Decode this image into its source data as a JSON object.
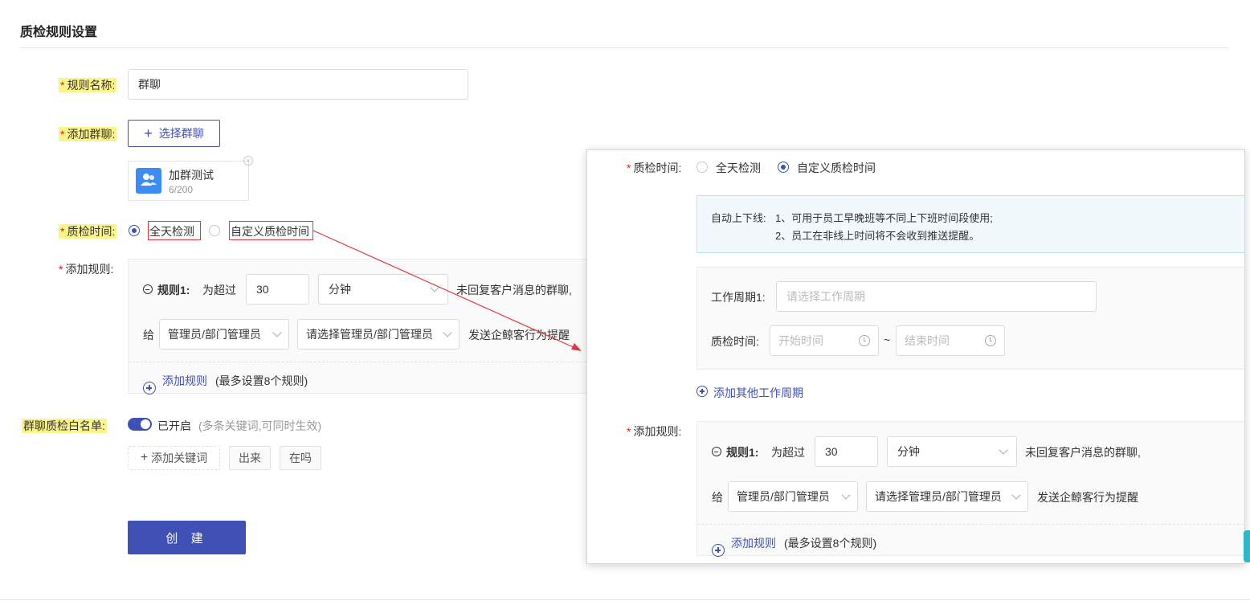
{
  "page": {
    "title": "质检规则设置"
  },
  "form": {
    "rule_name": {
      "label": "规则名称:",
      "value": "群聊"
    },
    "add_group": {
      "label": "添加群聊:",
      "button_label": "选择群聊"
    },
    "group_card": {
      "name": "加群测试",
      "count": "6/200",
      "logo_text": "群聊"
    },
    "check_time": {
      "label": "质检时间:",
      "options": [
        "全天检测",
        "自定义质检时间"
      ],
      "selected": "全天检测"
    },
    "add_rules": {
      "label": "添加规则:",
      "rule": {
        "name": "规则1:",
        "prefix": "为超过",
        "minutes": "30",
        "unit": "分钟",
        "suffix": "未回复客户消息的群聊,",
        "give": "给",
        "role": "管理员/部门管理员",
        "manager_placeholder": "请选择管理员/部门管理员",
        "action": "发送企鲸客行为提醒"
      },
      "add_link": "添加规则",
      "add_hint": "(最多设置8个规则)"
    },
    "whitelist": {
      "label": "群聊质检白名单:",
      "status": "已开启",
      "hint": "(多条关键词,可同时生效)",
      "add_keyword": "添加关键词",
      "tags": [
        "出来",
        "在吗"
      ]
    },
    "submit_label": "创 建"
  },
  "overlay": {
    "check_time": {
      "label": "质检时间:",
      "options": [
        "全天检测",
        "自定义质检时间"
      ],
      "selected": "自定义质检时间"
    },
    "notice": {
      "title": "自动上下线:",
      "lines": [
        "1、可用于员工早晚班等不同上下班时间段使用;",
        "2、员工在非线上时间将不会收到推送提醒。"
      ]
    },
    "work_cycle": {
      "label": "工作周期1:",
      "placeholder": "请选择工作周期",
      "time_label": "质检时间:",
      "start_placeholder": "开始时间",
      "separator": "~",
      "end_placeholder": "结束时间"
    },
    "add_cycle_link": "添加其他工作周期",
    "add_rules": {
      "label": "添加规则:",
      "rule": {
        "name": "规则1:",
        "prefix": "为超过",
        "minutes": "30",
        "unit": "分钟",
        "suffix": "未回复客户消息的群聊,",
        "give": "给",
        "role": "管理员/部门管理员",
        "manager_placeholder": "请选择管理员/部门管理员",
        "action": "发送企鲸客行为提醒"
      },
      "add_link": "添加规则",
      "add_hint": "(最多设置8个规则)"
    }
  },
  "colors": {
    "primary": "#3f51b5",
    "highlight": "#fbf48a",
    "required": "#e2231a",
    "annotation": "#e0383e"
  }
}
